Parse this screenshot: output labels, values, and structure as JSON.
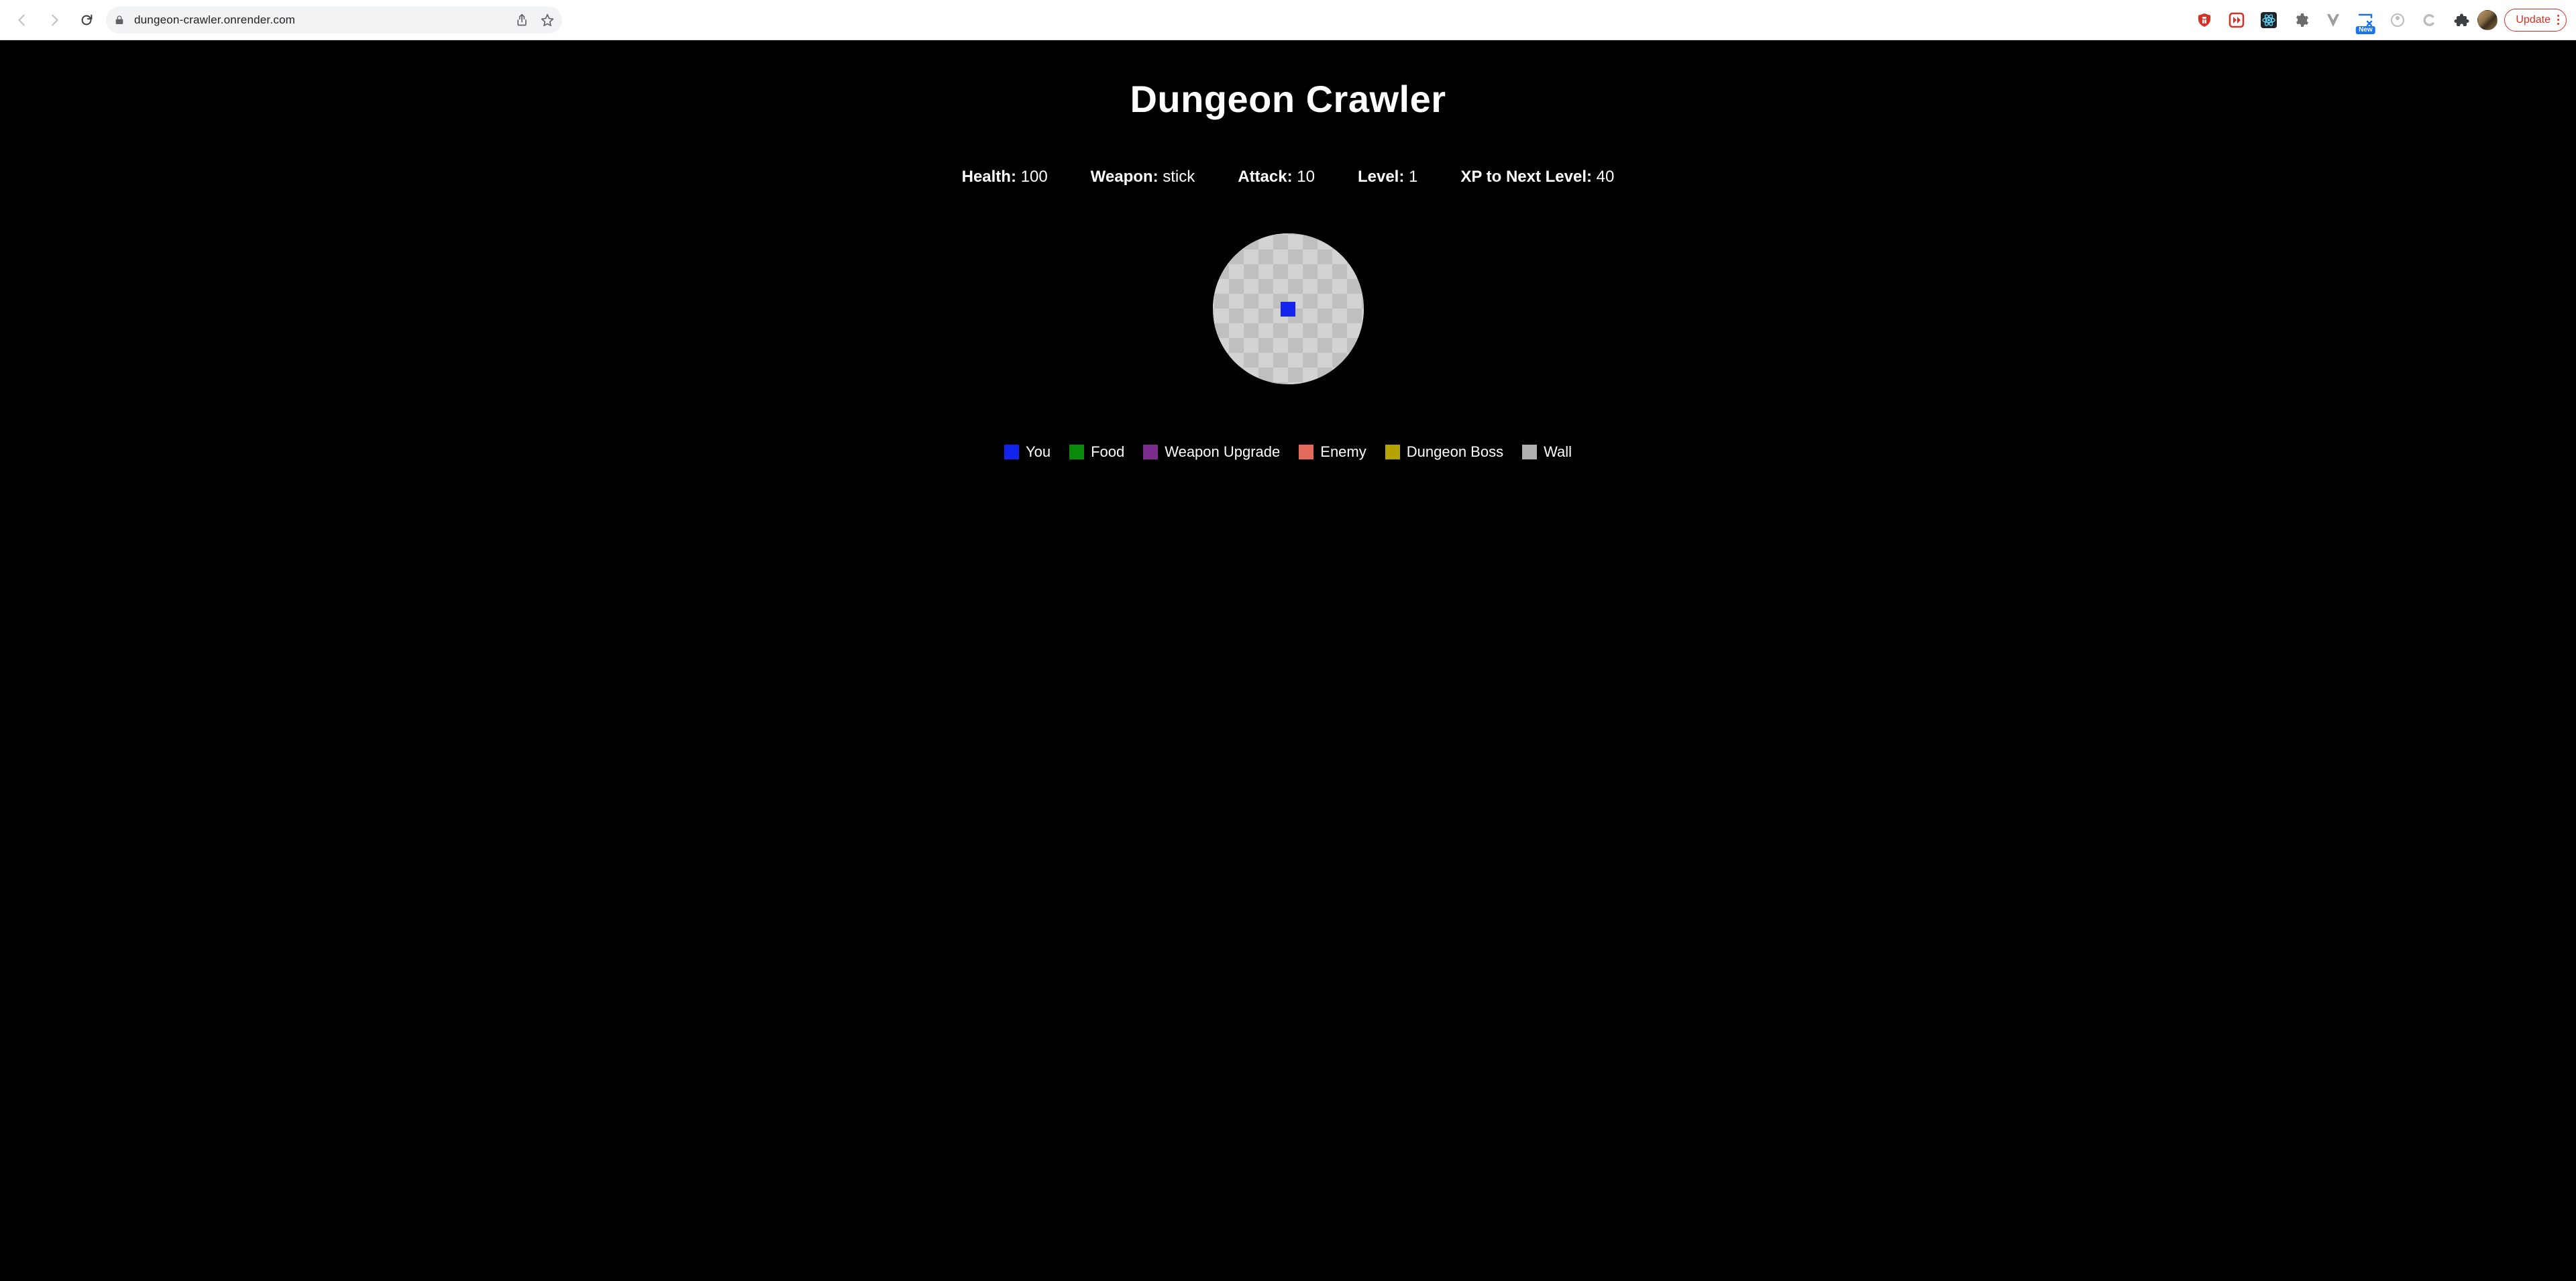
{
  "browser": {
    "url": "dungeon-crawler.onrender.com",
    "update_label": "Update",
    "new_badge": "New"
  },
  "game": {
    "title": "Dungeon Crawler",
    "stats": {
      "health": {
        "label": "Health:",
        "value": "100"
      },
      "weapon": {
        "label": "Weapon:",
        "value": "stick"
      },
      "attack": {
        "label": "Attack:",
        "value": "10"
      },
      "level": {
        "label": "Level:",
        "value": "1"
      },
      "xp": {
        "label": "XP to Next Level:",
        "value": "40"
      }
    },
    "colors": {
      "you": "#1324ec",
      "food": "#0a8a0a",
      "weapon_upgrade": "#7b2d8e",
      "enemy": "#e46a5e",
      "dungeon_boss": "#b5a400",
      "wall": "#b0b0b0"
    },
    "legend": {
      "you": "You",
      "food": "Food",
      "weapon_upgrade": "Weapon Upgrade",
      "enemy": "Enemy",
      "dungeon_boss": "Dungeon Boss",
      "wall": "Wall"
    }
  }
}
